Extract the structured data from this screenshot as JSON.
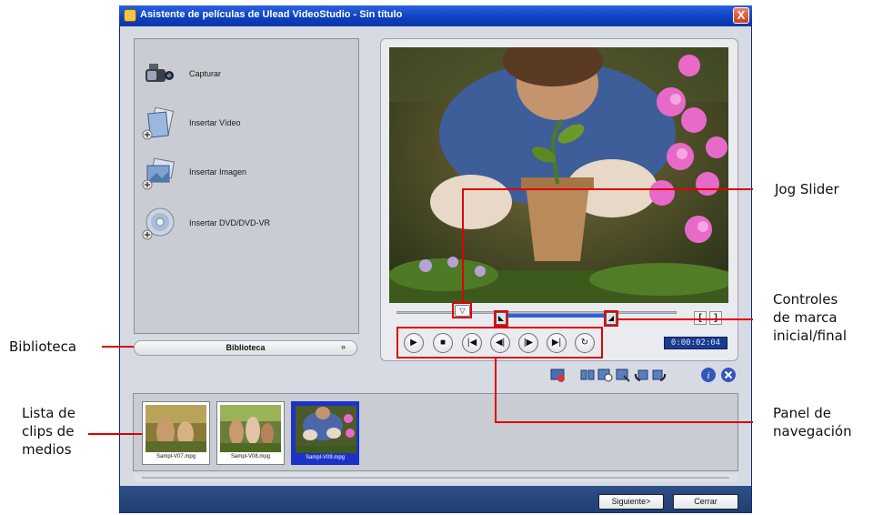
{
  "window": {
    "title": "Asistente de películas de Ulead VideoStudio - Sin título",
    "close_label": "X"
  },
  "left_panel": {
    "items": [
      {
        "label": "Capturar",
        "icon": "camcorder-icon"
      },
      {
        "label": "Insertar Vídeo",
        "icon": "video-file-icon"
      },
      {
        "label": "Insertar Imagen",
        "icon": "image-file-icon"
      },
      {
        "label": "Insertar DVD/DVD-VR",
        "icon": "dvd-disc-icon"
      }
    ],
    "library_button": "Biblioteca",
    "library_chevron": "»"
  },
  "preview": {
    "jog_glyph": "▽",
    "mark_in": "[",
    "mark_out": "]",
    "timecode": "0:00:02:04",
    "nav_buttons": [
      {
        "name": "play-button",
        "glyph": "▶"
      },
      {
        "name": "stop-button",
        "glyph": "■"
      },
      {
        "name": "go-to-start-button",
        "glyph": "|◀"
      },
      {
        "name": "previous-frame-button",
        "glyph": "◀|"
      },
      {
        "name": "next-frame-button",
        "glyph": "|▶"
      },
      {
        "name": "go-to-end-button",
        "glyph": "▶|"
      },
      {
        "name": "repeat-button",
        "glyph": "↻"
      }
    ]
  },
  "toolbar": {
    "icons": [
      "add-clip-icon",
      "split-clip-icon",
      "duration-icon",
      "properties-icon",
      "rotate-left-icon",
      "rotate-right-icon",
      "info-icon",
      "delete-icon"
    ]
  },
  "clips": [
    {
      "name": "Sampl-V07.mpg",
      "selected": false
    },
    {
      "name": "Sampl-V08.mpg",
      "selected": false
    },
    {
      "name": "Sampl-V09.mpg",
      "selected": true
    }
  ],
  "footer": {
    "next_label": "Siguiente>",
    "close_label": "Cerrar"
  },
  "callouts": {
    "jog_slider": "Jog Slider",
    "mark_controls": [
      "Controles",
      "de marca",
      "inicial/final"
    ],
    "library": "Biblioteca",
    "clip_list": [
      "Lista de",
      "clips de",
      "medios"
    ],
    "nav_panel": [
      "Panel de",
      "navegación"
    ]
  },
  "colors": {
    "callout_red": "#e00000",
    "titlebar_blue": "#0d3fc0",
    "selection_blue": "#1c32c8"
  }
}
